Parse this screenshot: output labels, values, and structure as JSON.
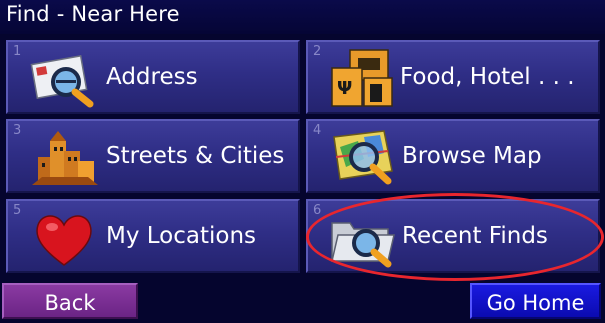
{
  "title": "Find - Near Here",
  "tiles": [
    {
      "number": "1",
      "label": "Address",
      "icon": "envelope-search-icon"
    },
    {
      "number": "2",
      "label": "Food, Hotel . . .",
      "icon": "food-hotel-icon"
    },
    {
      "number": "3",
      "label": "Streets & Cities",
      "icon": "city-buildings-icon"
    },
    {
      "number": "4",
      "label": "Browse Map",
      "icon": "map-magnifier-icon"
    },
    {
      "number": "5",
      "label": "My Locations",
      "icon": "heart-icon"
    },
    {
      "number": "6",
      "label": "Recent Finds",
      "icon": "folder-magnifier-icon"
    }
  ],
  "buttons": {
    "back": "Back",
    "go_home": "Go Home"
  },
  "colors": {
    "background": "#05052e",
    "tile": "#2f2e86",
    "back_button": "#7a2c93",
    "home_button": "#1212c8",
    "highlight_ring": "#e8262e"
  }
}
